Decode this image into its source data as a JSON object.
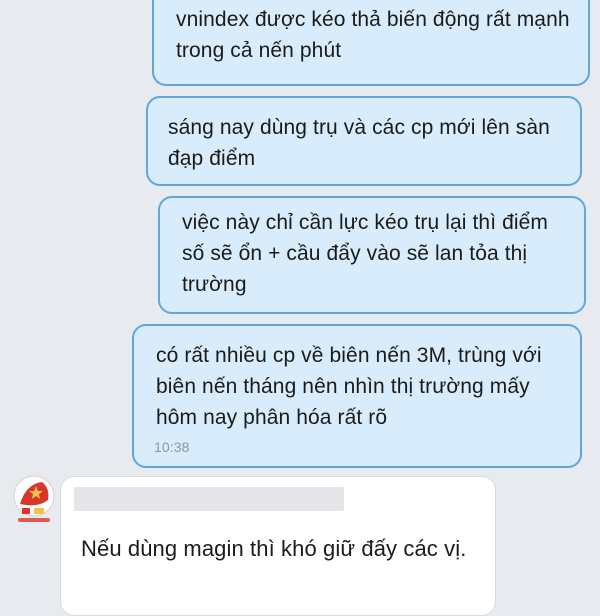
{
  "messages": [
    {
      "direction": "out",
      "text": "vnindex được kéo thả biến động rất mạnh trong cả nến phút"
    },
    {
      "direction": "out",
      "text": "sáng nay dùng trụ và các cp mới lên sàn đạp điểm"
    },
    {
      "direction": "out",
      "text": "việc này chỉ cần lực kéo trụ lại thì điểm số sẽ ổn + cầu đẩy vào sẽ lan tỏa thị trường"
    },
    {
      "direction": "out",
      "text": "có rất nhiều cp về biên nến 3M, trùng với biên nến tháng nên nhìn thị trường mấy hôm nay phân hóa rất rõ",
      "time": "10:38"
    },
    {
      "direction": "in",
      "sender_name": "",
      "text": "Nếu dùng magin thì khó giữ đấy các vị."
    }
  ],
  "colors": {
    "background": "#e7ebf0",
    "outgoing_bubble": "#d8ecfb",
    "outgoing_border": "#5fa6dc",
    "incoming_bubble": "#ffffff",
    "avatar_red": "#d9362b",
    "avatar_gold": "#f2c14e"
  },
  "icons": {
    "avatar": "avatar-flag-icon"
  }
}
